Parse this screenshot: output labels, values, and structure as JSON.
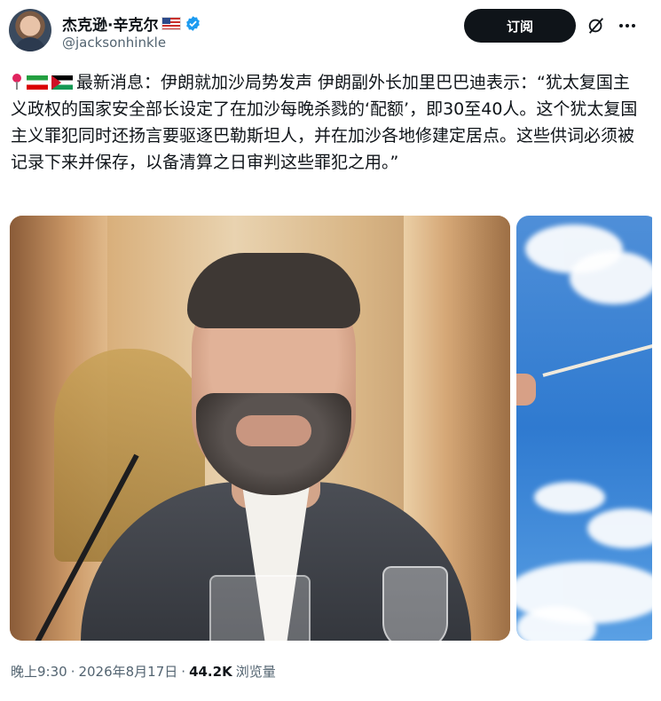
{
  "author": {
    "display_name": "杰克逊·辛克尔",
    "handle": "@jacksonhinkle"
  },
  "header": {
    "subscribe_label": "订阅"
  },
  "icons": {
    "pin": "round-pushpin-icon",
    "flags": [
      "iran-flag-icon",
      "palestine-flag-icon"
    ],
    "verified": "verified-badge-icon",
    "grok": "grok-icon",
    "more": "more-icon"
  },
  "tweet": {
    "text": "最新消息：伊朗就加沙局势发声 伊朗副外长加里巴巴迪表示：“犹太复国主义政权的国家安全部长设定了在加沙每晚杀戮的‘配额’，即30至40人。这个犹太复国主义罪犯同时还扬言要驱逐巴勒斯坦人，并在加沙各地修建定居点。这些供词必须被记录下来并保存，以备清算之日审判这些罪犯之用。”"
  },
  "meta": {
    "time": "晚上9:30",
    "separator": "·",
    "date": "2026年8月17日",
    "views_count": "44.2K",
    "views_label": "浏览量"
  },
  "colors": {
    "text_primary": "#0f1419",
    "text_secondary": "#536471",
    "verified_blue": "#1d9bf0",
    "button_bg": "#0f1419"
  }
}
